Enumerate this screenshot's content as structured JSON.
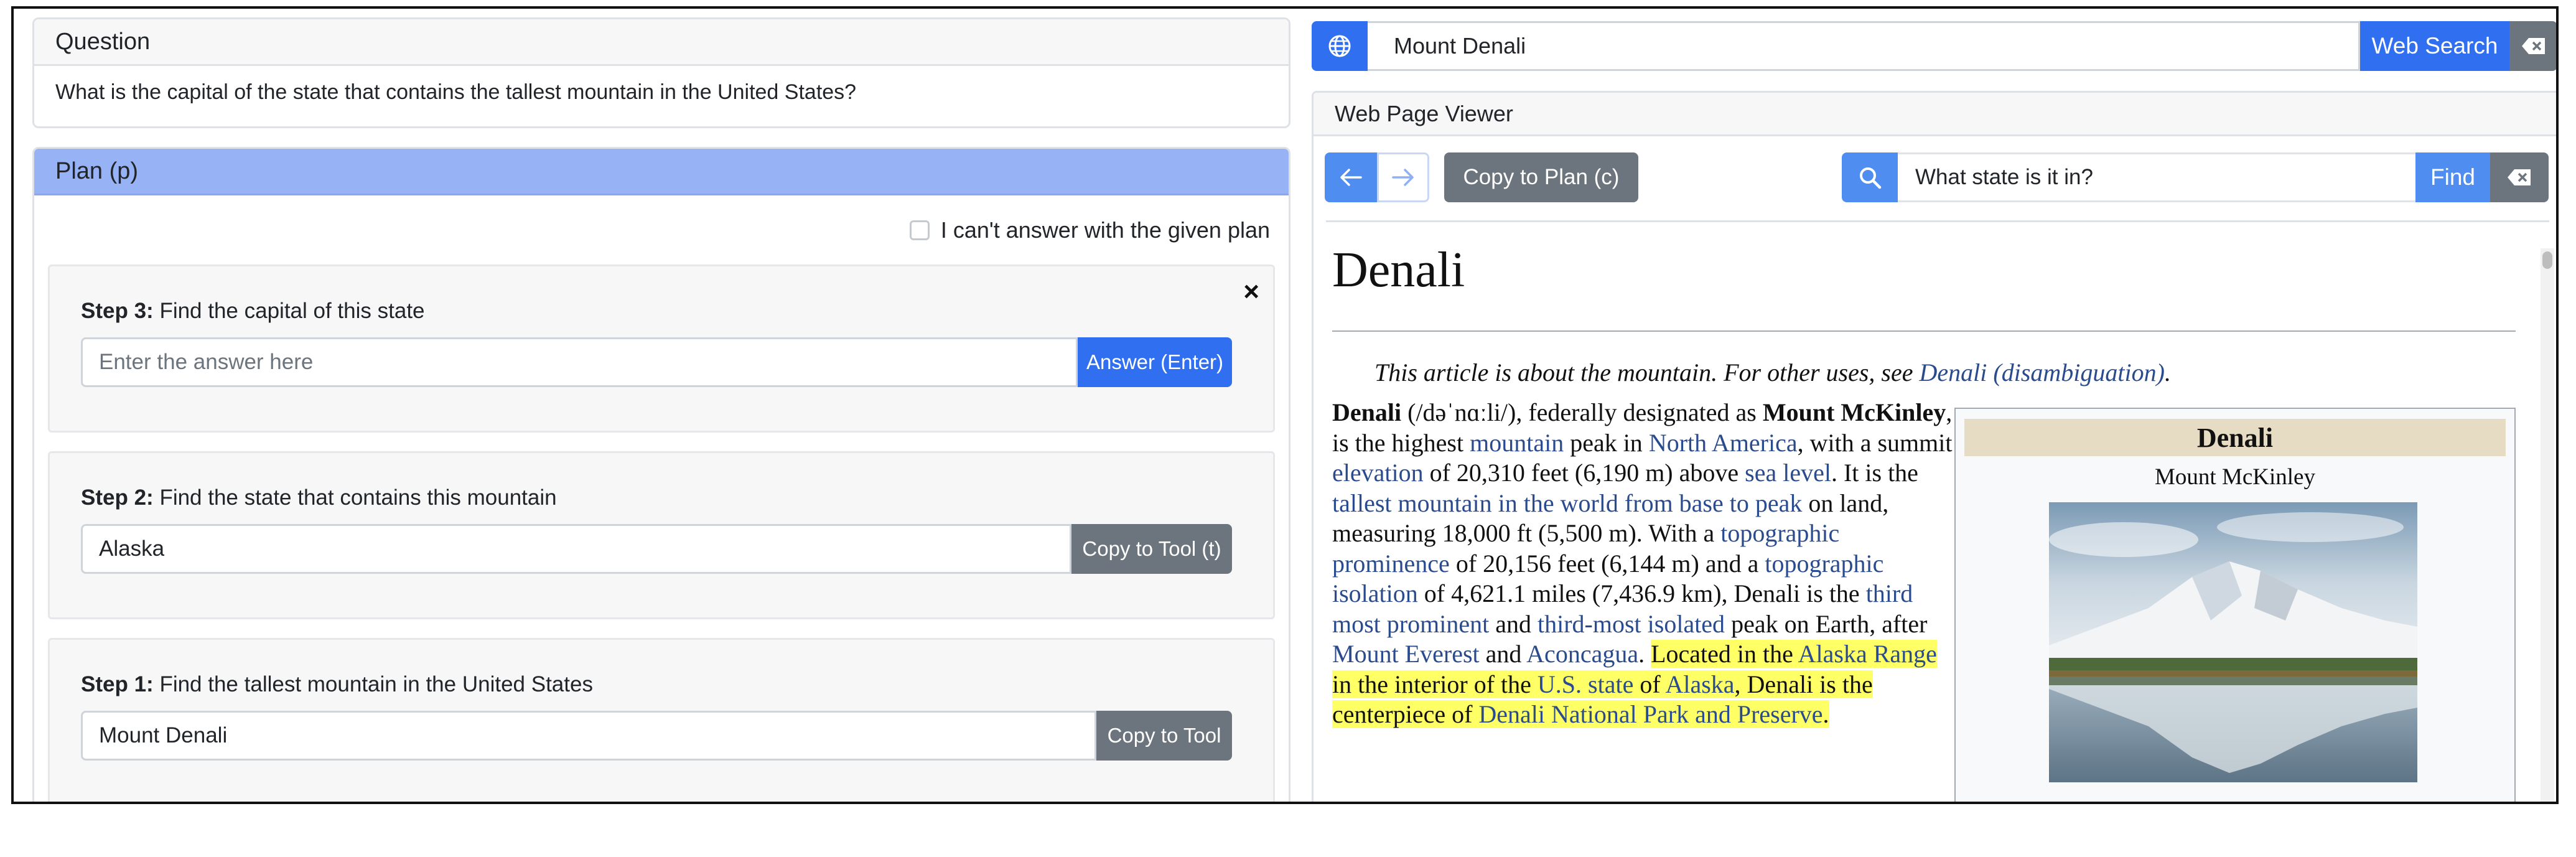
{
  "question": {
    "header": "Question",
    "text": "What is the capital of the state that contains the tallest mountain in the United States?"
  },
  "plan": {
    "header": "Plan (p)",
    "cant_answer_label": "I can't answer with the given plan",
    "steps": [
      {
        "label": "Step 3:",
        "text": "Find the capital of this state",
        "placeholder": "Enter the answer here",
        "value": "",
        "button": "Answer (Enter)"
      },
      {
        "label": "Step 2:",
        "text": "Find the state that contains this mountain",
        "value": "Alaska",
        "button": "Copy to Tool (t)"
      },
      {
        "label": "Step 1:",
        "text": "Find the tallest mountain in the United States",
        "value": "Mount Denali",
        "button": "Copy to Tool"
      }
    ]
  },
  "web_search": {
    "query": "Mount Denali",
    "button": "Web Search"
  },
  "viewer": {
    "header": "Web Page Viewer",
    "copy_button": "Copy to Plan (c)",
    "find_query": "What state is it in?",
    "find_button": "Find"
  },
  "article": {
    "title": "Denali",
    "hatnote_prefix": "This article is about the mountain. For other uses, see ",
    "hatnote_link": "Denali (disambiguation)",
    "hatnote_suffix": ".",
    "p": {
      "t1": "Denali",
      "t2": " (/dəˈnɑːli/), federally designated as ",
      "t3": "Mount McKinley",
      "t4": ", is the highest ",
      "l1": "mountain",
      "t5": " peak in ",
      "l2": "North America",
      "t6": ", with a summit ",
      "l3": "elevation",
      "t7": " of 20,310 feet (6,190 m) above ",
      "l4": "sea level",
      "t8": ". It is the ",
      "l5": "tallest mountain in the world from base to peak",
      "t9": " on land, measuring 18,000 ft (5,500 m). With a ",
      "l6": "topographic prominence",
      "t10": " of 20,156 feet (6,144 m) and a ",
      "l7": "topographic isolation",
      "t11": " of 4,621.1 miles (7,436.9 km), Denali is the ",
      "l8": "third most prominent",
      "t12": " and ",
      "l9": "third-most isolated",
      "t13": " peak on Earth, after ",
      "l10": "Mount Everest",
      "t14": " and ",
      "l11": "Aconcagua",
      "t15": ". ",
      "h1": "Located in the ",
      "hl1": "Alaska Range",
      "h2": " in the interior of the ",
      "hl2": "U.S. state",
      "h3": " of ",
      "hl3": "Alaska",
      "h4": ", Denali is the centerpiece of ",
      "hl4": "Denali National Park and Preserve",
      "h5": "."
    },
    "infobox": {
      "title": "Denali",
      "subtitle": "Mount McKinley"
    }
  },
  "colors": {
    "primary": "#2f6ff0",
    "secondary": "#6c757d",
    "plan_header": "#98b3f5",
    "link": "#2a4b8d",
    "highlight": "#ffff66"
  }
}
